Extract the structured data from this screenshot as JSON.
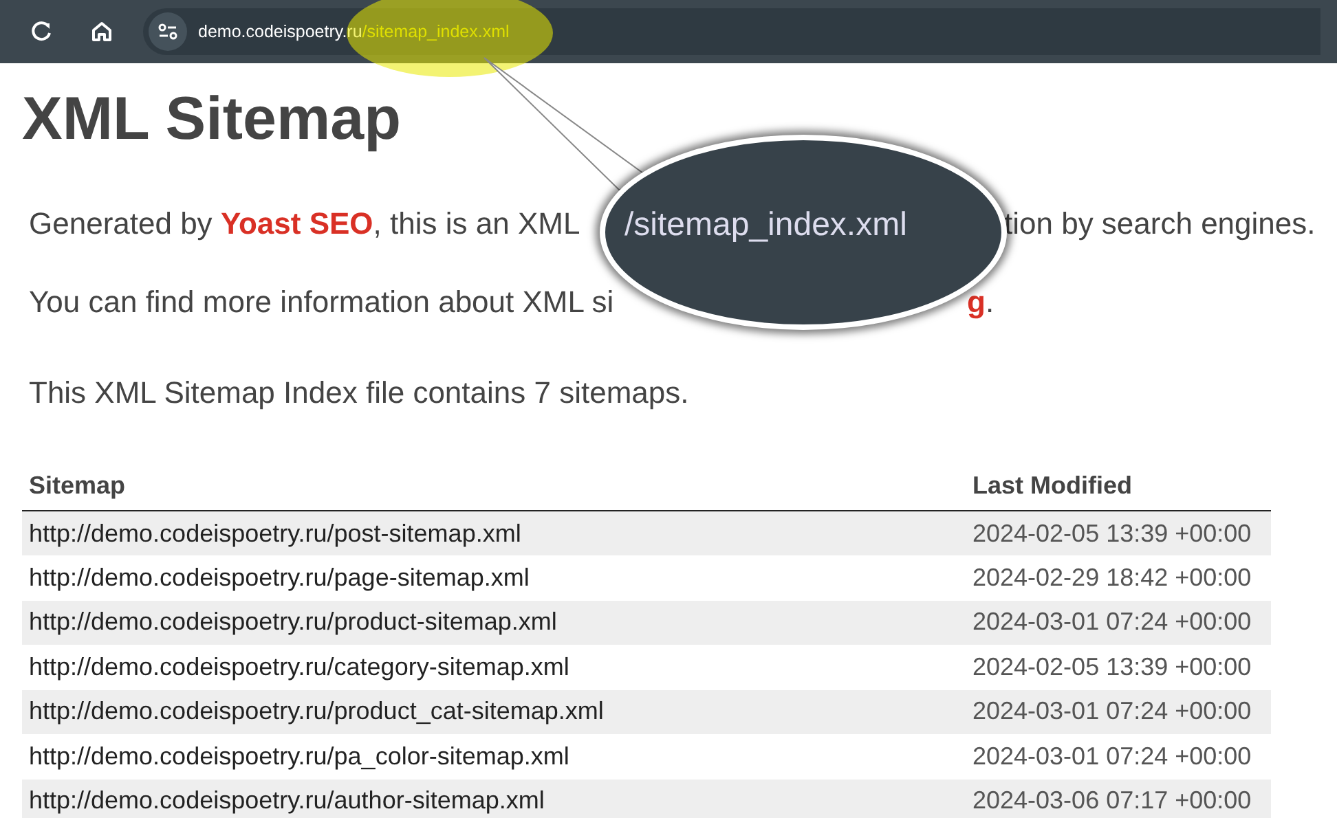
{
  "browser": {
    "url_host": "demo.codeispoetry.ru",
    "url_path": "/sitemap_index.xml"
  },
  "title": "XML Sitemap",
  "paragraph_1": {
    "left": "Generated by **Yoast SEO**, this is an XML",
    "right": "tion by search engines."
  },
  "paragraph_2": {
    "left": "You can find more information about XML si",
    "right_link": "g",
    "right_tail": "."
  },
  "paragraph_3": "This XML Sitemap Index file contains 7 sitemaps.",
  "callout": {
    "text": "/sitemap_index.xml"
  },
  "table": {
    "columns": [
      "Sitemap",
      "Last Modified"
    ],
    "rows": [
      [
        "http://demo.codeispoetry.ru/post-sitemap.xml",
        "2024-02-05 13:39 +00:00"
      ],
      [
        "http://demo.codeispoetry.ru/page-sitemap.xml",
        "2024-02-29 18:42 +00:00"
      ],
      [
        "http://demo.codeispoetry.ru/product-sitemap.xml",
        "2024-03-01 07:24 +00:00"
      ],
      [
        "http://demo.codeispoetry.ru/category-sitemap.xml",
        "2024-02-05 13:39 +00:00"
      ],
      [
        "http://demo.codeispoetry.ru/product_cat-sitemap.xml",
        "2024-03-01 07:24 +00:00"
      ],
      [
        "http://demo.codeispoetry.ru/pa_color-sitemap.xml",
        "2024-03-01 07:24 +00:00"
      ],
      [
        "http://demo.codeispoetry.ru/author-sitemap.xml",
        "2024-03-06 07:17 +00:00"
      ]
    ]
  }
}
